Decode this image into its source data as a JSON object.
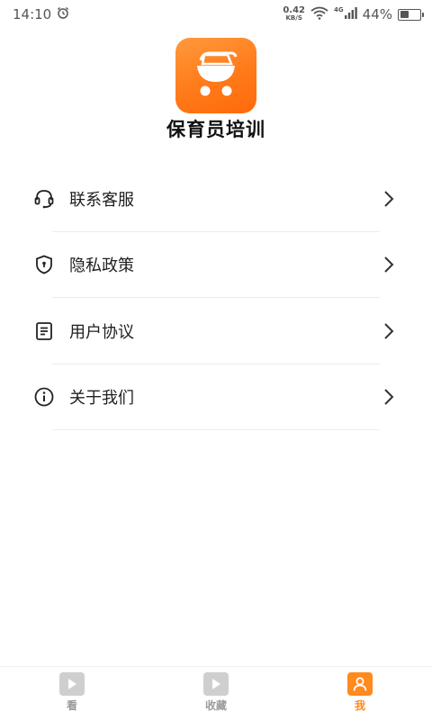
{
  "status_bar": {
    "time": "14:10",
    "net_speed_value": "0.42",
    "net_speed_unit": "KB/S",
    "network_type": "4G",
    "battery_percent": "44%",
    "battery_level": 0.44
  },
  "app": {
    "name": "保育员培训",
    "logo_icon": "stroller-icon",
    "brand_color": "#ff7a1a"
  },
  "menu": {
    "items": [
      {
        "label": "联系客服",
        "icon": "headset-icon"
      },
      {
        "label": "隐私政策",
        "icon": "shield-icon"
      },
      {
        "label": "用户协议",
        "icon": "document-icon"
      },
      {
        "label": "关于我们",
        "icon": "info-icon"
      }
    ]
  },
  "bottom_nav": {
    "tabs": [
      {
        "label": "看",
        "icon": "play-video-icon",
        "active": false
      },
      {
        "label": "收藏",
        "icon": "play-video-icon",
        "active": false
      },
      {
        "label": "我",
        "icon": "user-icon",
        "active": true
      }
    ],
    "active_color": "#ff8a1e",
    "inactive_color": "#c8c8c8"
  }
}
